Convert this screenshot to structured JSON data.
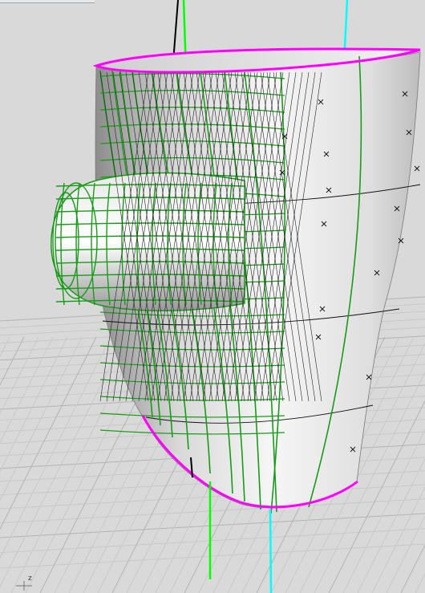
{
  "viewport": {
    "axis_indicator_label": "z",
    "colors": {
      "background": "#d9d9d9",
      "grid_minor": "#c7c7c7",
      "grid_major": "#b5b5b5",
      "surface_light": "#f4f4f4",
      "surface_dark": "#9a9a9a",
      "wire_green": "#1a9a1a",
      "edge_magenta": "#ff00ff",
      "axis_green": "#00ff00",
      "axis_cyan": "#00ffff",
      "axis_black": "#000000"
    }
  }
}
